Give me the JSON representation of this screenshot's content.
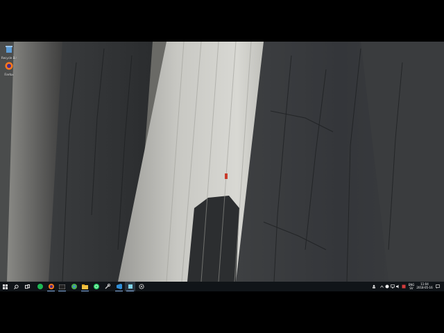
{
  "desktop": {
    "icons": [
      {
        "label": "Recycle Bin",
        "icon": "recycle-bin-icon"
      },
      {
        "label": "Firefox",
        "icon": "firefox-icon"
      }
    ]
  },
  "taskbar": {
    "apps": [
      {
        "name": "start",
        "icon": "windows-start-icon"
      },
      {
        "name": "search",
        "icon": "search-icon"
      },
      {
        "name": "task-view",
        "icon": "task-view-icon"
      },
      {
        "name": "spotify",
        "icon": "spotify-icon"
      },
      {
        "name": "firefox",
        "icon": "firefox-icon"
      },
      {
        "name": "terminal",
        "icon": "terminal-icon"
      },
      {
        "name": "chrome",
        "icon": "chrome-icon"
      },
      {
        "name": "file-explorer",
        "icon": "folder-icon"
      },
      {
        "name": "whatsapp",
        "icon": "whatsapp-icon"
      },
      {
        "name": "tools",
        "icon": "wrench-icon"
      },
      {
        "name": "visual-studio",
        "icon": "visual-studio-icon"
      },
      {
        "name": "screen-recorder",
        "icon": "screen-recorder-icon"
      },
      {
        "name": "settings",
        "icon": "gear-icon"
      }
    ],
    "tray": {
      "language_top": "ENG",
      "language_bottom": "SV",
      "time": "11:04",
      "date": "2018-05-16"
    }
  },
  "colors": {
    "taskbar_bg": "#101418",
    "active_indicator": "#8ab4e8",
    "climber": "#c83a2a"
  }
}
